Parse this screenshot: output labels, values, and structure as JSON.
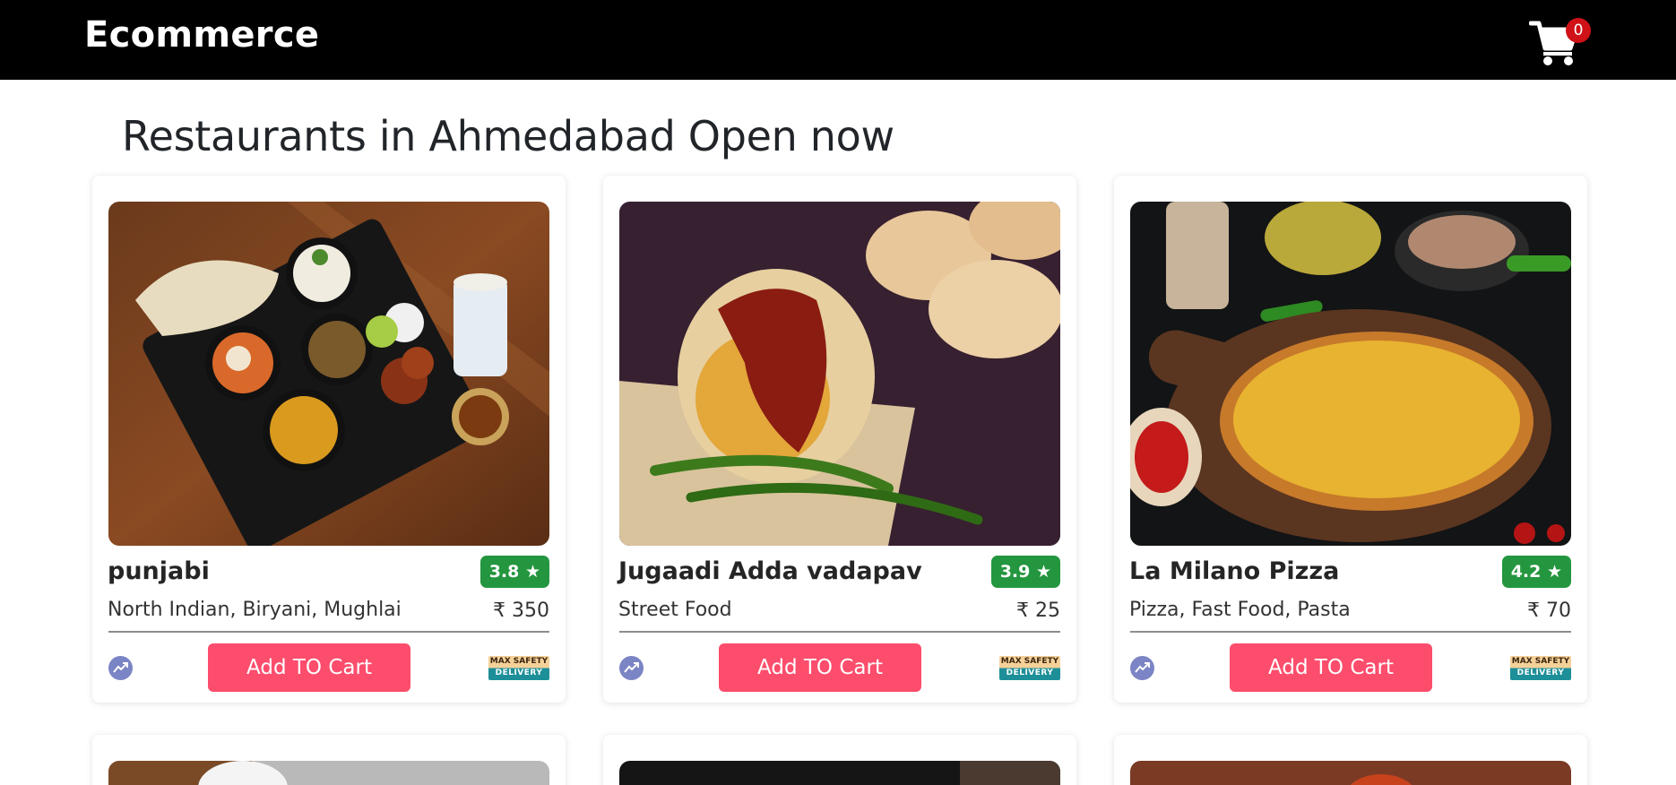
{
  "navbar": {
    "brand": "Ecommerce",
    "cart_count": "0"
  },
  "page_title": "Restaurants in Ahmedabad Open now",
  "button_label": "Add TO Cart",
  "safety_badge": {
    "line1": "MAX SAFETY",
    "line2": "DELIVERY"
  },
  "restaurants": [
    {
      "name": "punjabi",
      "rating": "3.8 ★",
      "cuisine": "North Indian, Biryani, Mughlai",
      "price": "₹ 350"
    },
    {
      "name": "Jugaadi Adda vadapav",
      "rating": "3.9 ★",
      "cuisine": "Street Food",
      "price": "₹ 25"
    },
    {
      "name": "La Milano Pizza",
      "rating": "4.2 ★",
      "cuisine": "Pizza, Fast Food, Pasta",
      "price": "₹ 70"
    }
  ],
  "colors": {
    "navbar": "#000000",
    "rating": "#24963f",
    "button": "#fc4d6c",
    "badge": "#d01117"
  }
}
